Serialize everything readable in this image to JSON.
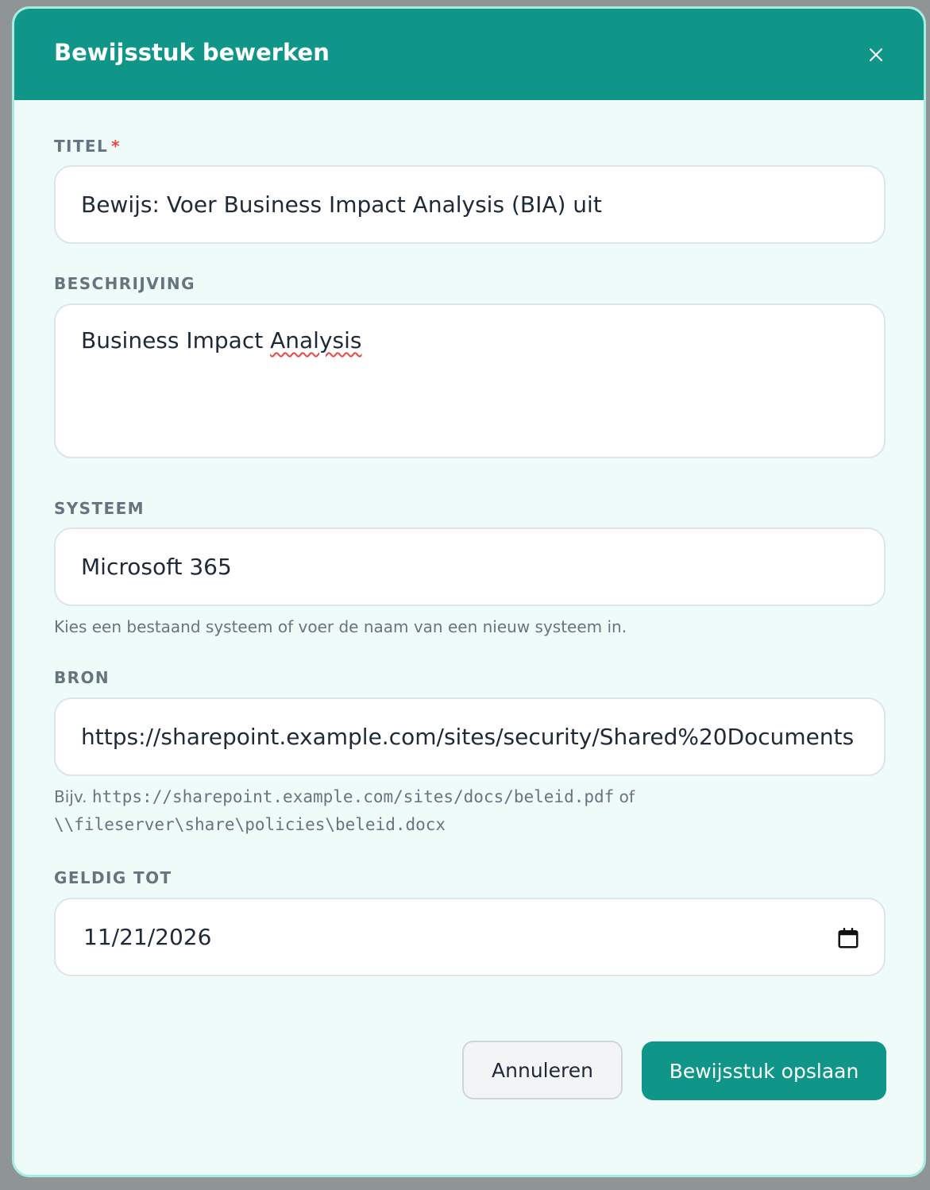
{
  "dialog": {
    "title": "Bewijsstuk bewerken",
    "close_icon": "close-icon"
  },
  "fields": {
    "title": {
      "label": "TITEL",
      "required_mark": "*",
      "value": "Bewijs: Voer Business Impact Analysis (BIA) uit"
    },
    "description": {
      "label": "BESCHRIJVING",
      "value_before": "Business Impact ",
      "value_misspelled": "Analysis"
    },
    "system": {
      "label": "SYSTEEM",
      "value": "Microsoft 365",
      "helper": "Kies een bestaand systeem of voer de naam van een nieuw systeem in."
    },
    "source": {
      "label": "BRON",
      "value": "https://sharepoint.example.com/sites/security/Shared%20Documents",
      "helper_prefix": "Bijv.",
      "helper_example_1": "https://sharepoint.example.com/sites/docs/beleid.pdf",
      "helper_or": "of",
      "helper_example_2": "\\\\fileserver\\share\\policies\\beleid.docx"
    },
    "valid_until": {
      "label": "GELDIG TOT",
      "value": "11/21/2026",
      "icon": "calendar-icon"
    }
  },
  "actions": {
    "cancel_label": "Annuleren",
    "save_label": "Bewijsstuk opslaan"
  },
  "colors": {
    "header": "#0f9688",
    "body": "#effbf8",
    "border": "#a7ece0",
    "required": "#ef4444"
  }
}
